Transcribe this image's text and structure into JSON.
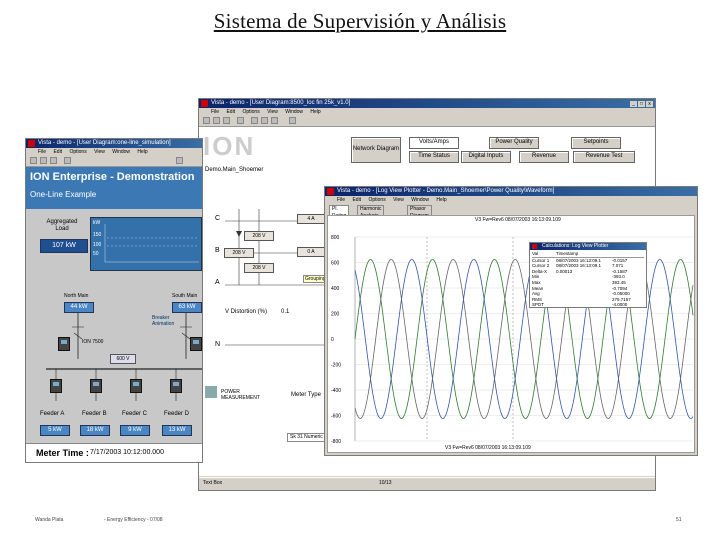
{
  "slide": {
    "title": "Sistema de Supervisión y Análisis",
    "footer_left": "Wanda Plata",
    "footer_center": "- Energy Efficiency - 07/08",
    "page_number": "51"
  },
  "back_window": {
    "title": "Vista - demo - [User Diagram:8500_loc fin 25k_v1.0]",
    "menu": [
      "File",
      "Edit",
      "Options",
      "View",
      "Window",
      "Help"
    ],
    "buttons": [
      "Network Diagram",
      "Volts/Amps",
      "Power Quality",
      "Setpoints",
      "Time Status",
      "Digital Inputs",
      "Revenue",
      "Revenue Test"
    ],
    "selected_button": "Volts/Amps",
    "diagram_name": "Demo.Main_Shoemer",
    "phases": [
      "C",
      "B",
      "A",
      "N"
    ],
    "values_phase": [
      "208 V",
      "208 V",
      "208 V"
    ],
    "values_line": [
      "4 A",
      "0 A"
    ],
    "values_b": "208 V",
    "grouping_label": "Grouping Object",
    "distortion_label": "V Distortion (%)",
    "distortion_value": "0.1",
    "meter_type_label": "Meter Type",
    "brand_text": "ION",
    "brand_sub": "POWER MEASUREMENT",
    "status_left": "Text Box",
    "status_right": "10/13",
    "status_tab": "Sk 31 Numeric Object Main Schema_loc_ba"
  },
  "left_window": {
    "title": "Vista - demo - [User Diagram:one-line_simulation]",
    "menu": [
      "File",
      "Edit",
      "Options",
      "View",
      "Window",
      "Help"
    ],
    "header_title": "ION Enterprise - Demonstration",
    "header_sub": "One-Line Example",
    "aggregated_label": "Aggregated Load",
    "aggregated_value": "107 kW",
    "main_left_label": "North Main",
    "main_left_value": "44 kW",
    "main_right_label": "South Main",
    "main_right_value": "63 kW",
    "breaker_label": "Breaker Animation",
    "meter_label": "ION 7500",
    "bus_voltage": "600 V",
    "feeders": [
      {
        "name": "Feeder A",
        "value": "5 kW"
      },
      {
        "name": "Feeder B",
        "value": "18 kW"
      },
      {
        "name": "Feeder C",
        "value": "9 kW"
      },
      {
        "name": "Feeder D",
        "value": "13 kW"
      }
    ],
    "meter_time_label": "Meter Time :",
    "meter_time_value": "7/17/2003 10:12:00.000",
    "chart_y_ticks": [
      "kW",
      "200",
      "150",
      "100",
      "50",
      "0"
    ]
  },
  "waveform_window": {
    "title": "Vista - demo - [Log View Plotter - Demo.Main_Shoemer\\Power Quality\\Waveform]",
    "menu": [
      "File",
      "Edit",
      "Options",
      "View",
      "Window",
      "Help"
    ],
    "tabs": [
      "Pl. Rating",
      "Harmonic Analysis",
      "Phasor Diagram"
    ],
    "chart_title": "V3 Fw=Rev6 08/07/2003 16:13:09.109",
    "y_ticks": [
      "800",
      "600",
      "400",
      "200",
      "0",
      "-200",
      "-400",
      "-600",
      "-800"
    ],
    "x_label": "V3 Fw=Rev6 08/07/2003 16:13:09.109",
    "calc_window": {
      "title": "Calculations: Log View Plotter",
      "col1": "Val",
      "col2": "Timestamp",
      "rows": [
        [
          "Cursor 1",
          "08/07/2003 16:13:09.1",
          "-0.0157"
        ],
        [
          "Cursor 2",
          "08/07/2003 16:13:09.1",
          "7.071"
        ],
        [
          "Delta-X",
          "0.00013",
          "-0.1587"
        ],
        [
          "Min",
          "",
          "-393.0"
        ],
        [
          "Max",
          "",
          "393.45"
        ],
        [
          "Mean",
          "",
          "-0.7094"
        ],
        [
          "Avg",
          "",
          "-0.05000"
        ],
        [
          "RMS",
          "",
          "275.7157"
        ],
        [
          "SPDT",
          "",
          "-4.0000"
        ]
      ]
    },
    "colors": {
      "phase_a": "#2f7a2f",
      "phase_b": "#3355aa",
      "phase_c": "#666666"
    }
  }
}
